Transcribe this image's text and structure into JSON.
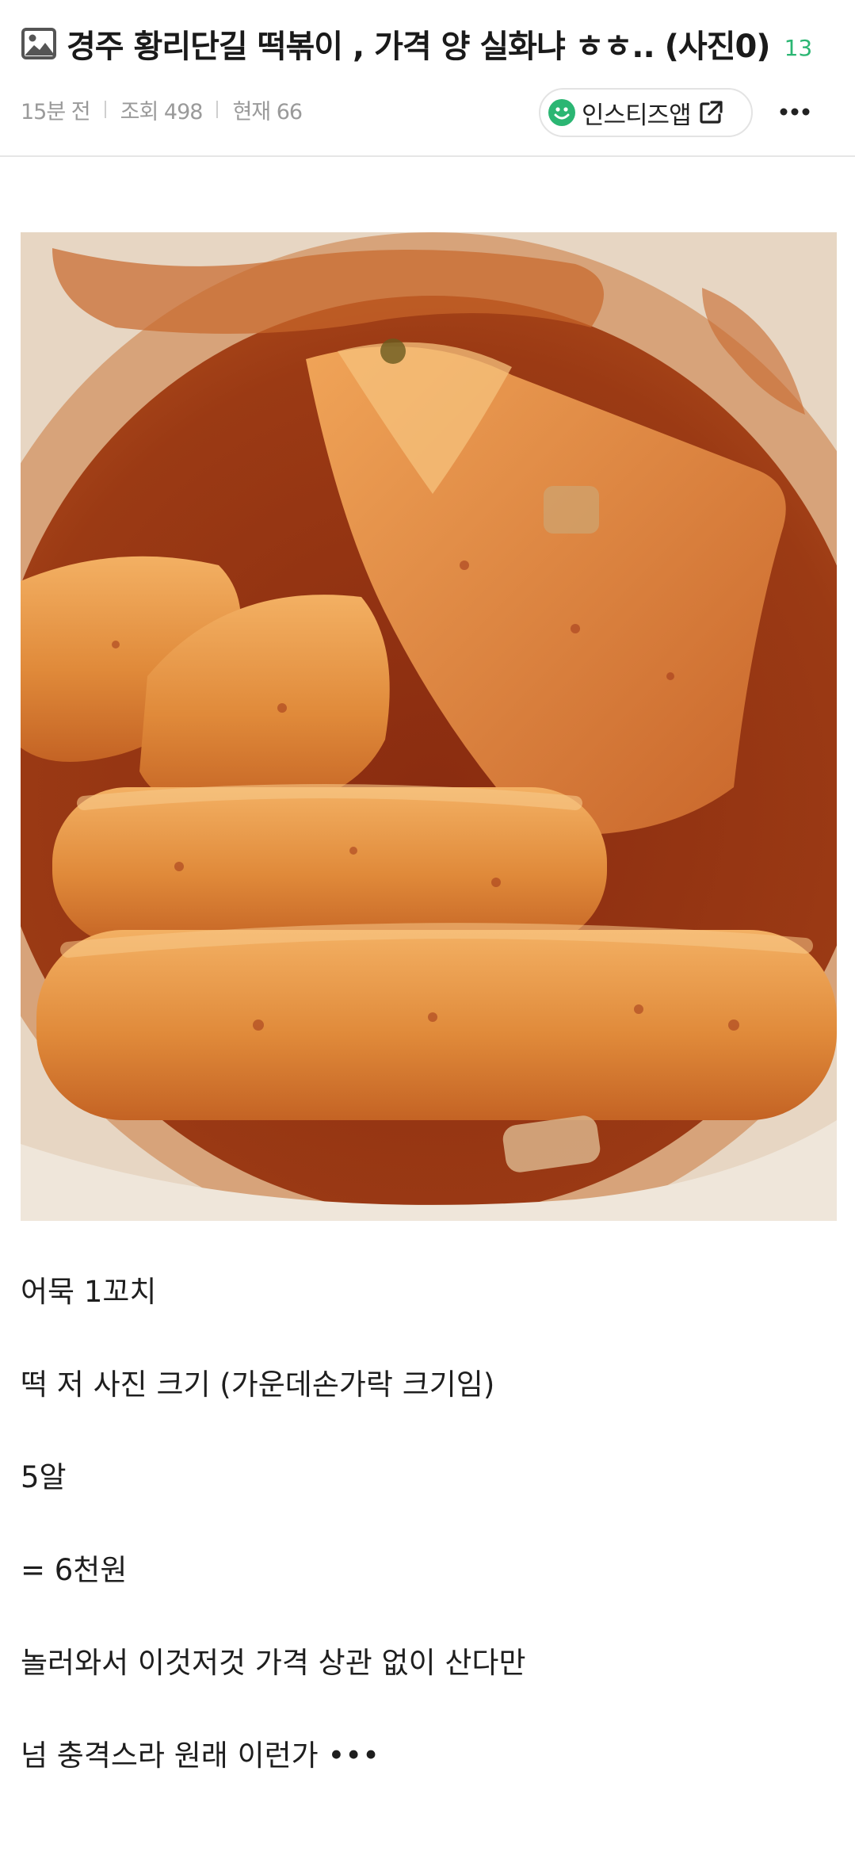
{
  "post": {
    "title": "경주 황리단길 떡볶이 , 가격 양 실화냐 ㅎㅎ.. (사진0)",
    "comment_count": "13",
    "time_ago": "15분 전",
    "views": "조회 498",
    "current": "현재 66",
    "app_button_label": "인스티즈앱"
  },
  "icons": {
    "title_icon": "image-icon",
    "app_icon": "smiley-icon",
    "external": "external-link-icon",
    "more": "more-dots-icon"
  },
  "colors": {
    "accent_green": "#2bb673",
    "meta_gray": "#9a9a9a"
  },
  "body_lines": [
    "어묵 1꼬치",
    "떡 저 사진 크기 (가운데손가락 크기임)",
    "5알",
    "= 6천원",
    "놀러와서 이것저것 가격 상관 없이 산다만",
    "넘 충격스라 원래 이런가 •••"
  ]
}
